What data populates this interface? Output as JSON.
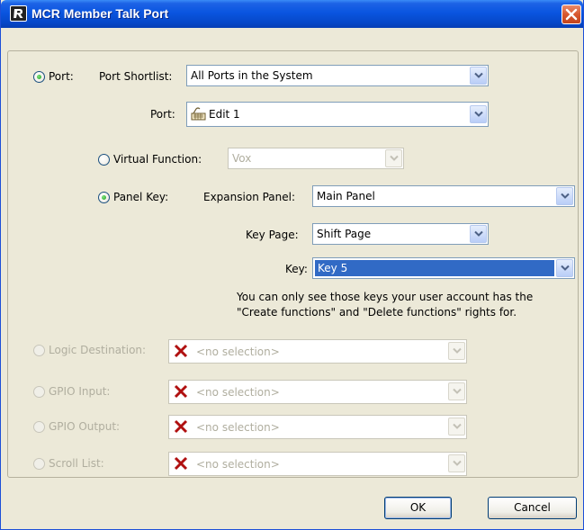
{
  "window": {
    "title": "MCR Member Talk Port",
    "app_icon": "r-logo-icon",
    "close_icon": "close-icon"
  },
  "port_group": {
    "radio_label": "Port:",
    "selected": true,
    "shortlist_label": "Port Shortlist:",
    "shortlist_value": "All Ports in the System",
    "port_label": "Port:",
    "port_value": "Edit 1",
    "port_icon": "keyboard-panel-icon"
  },
  "virtual_function": {
    "radio_label": "Virtual Function:",
    "selected": false,
    "value": "Vox"
  },
  "panel_key": {
    "radio_label": "Panel Key:",
    "selected": true,
    "expansion_label": "Expansion Panel:",
    "expansion_value": "Main Panel",
    "key_page_label": "Key Page:",
    "key_page_value": "Shift Page",
    "key_label": "Key:",
    "key_value": "Key 5",
    "info_line1": "You can only see those keys your user account has the",
    "info_line2": "\"Create functions\" and \"Delete functions\" rights for."
  },
  "disabled_options": [
    {
      "label": "Logic Destination:",
      "value": "<no selection>"
    },
    {
      "label": "GPIO Input:",
      "value": "<no selection>"
    },
    {
      "label": "GPIO Output:",
      "value": "<no selection>"
    },
    {
      "label": "Scroll List:",
      "value": "<no selection>"
    }
  ],
  "buttons": {
    "ok": "OK",
    "cancel": "Cancel"
  },
  "colors": {
    "titlebar": "#0a55e0",
    "selection": "#316ac5",
    "invalid_mark": "#b01010"
  }
}
